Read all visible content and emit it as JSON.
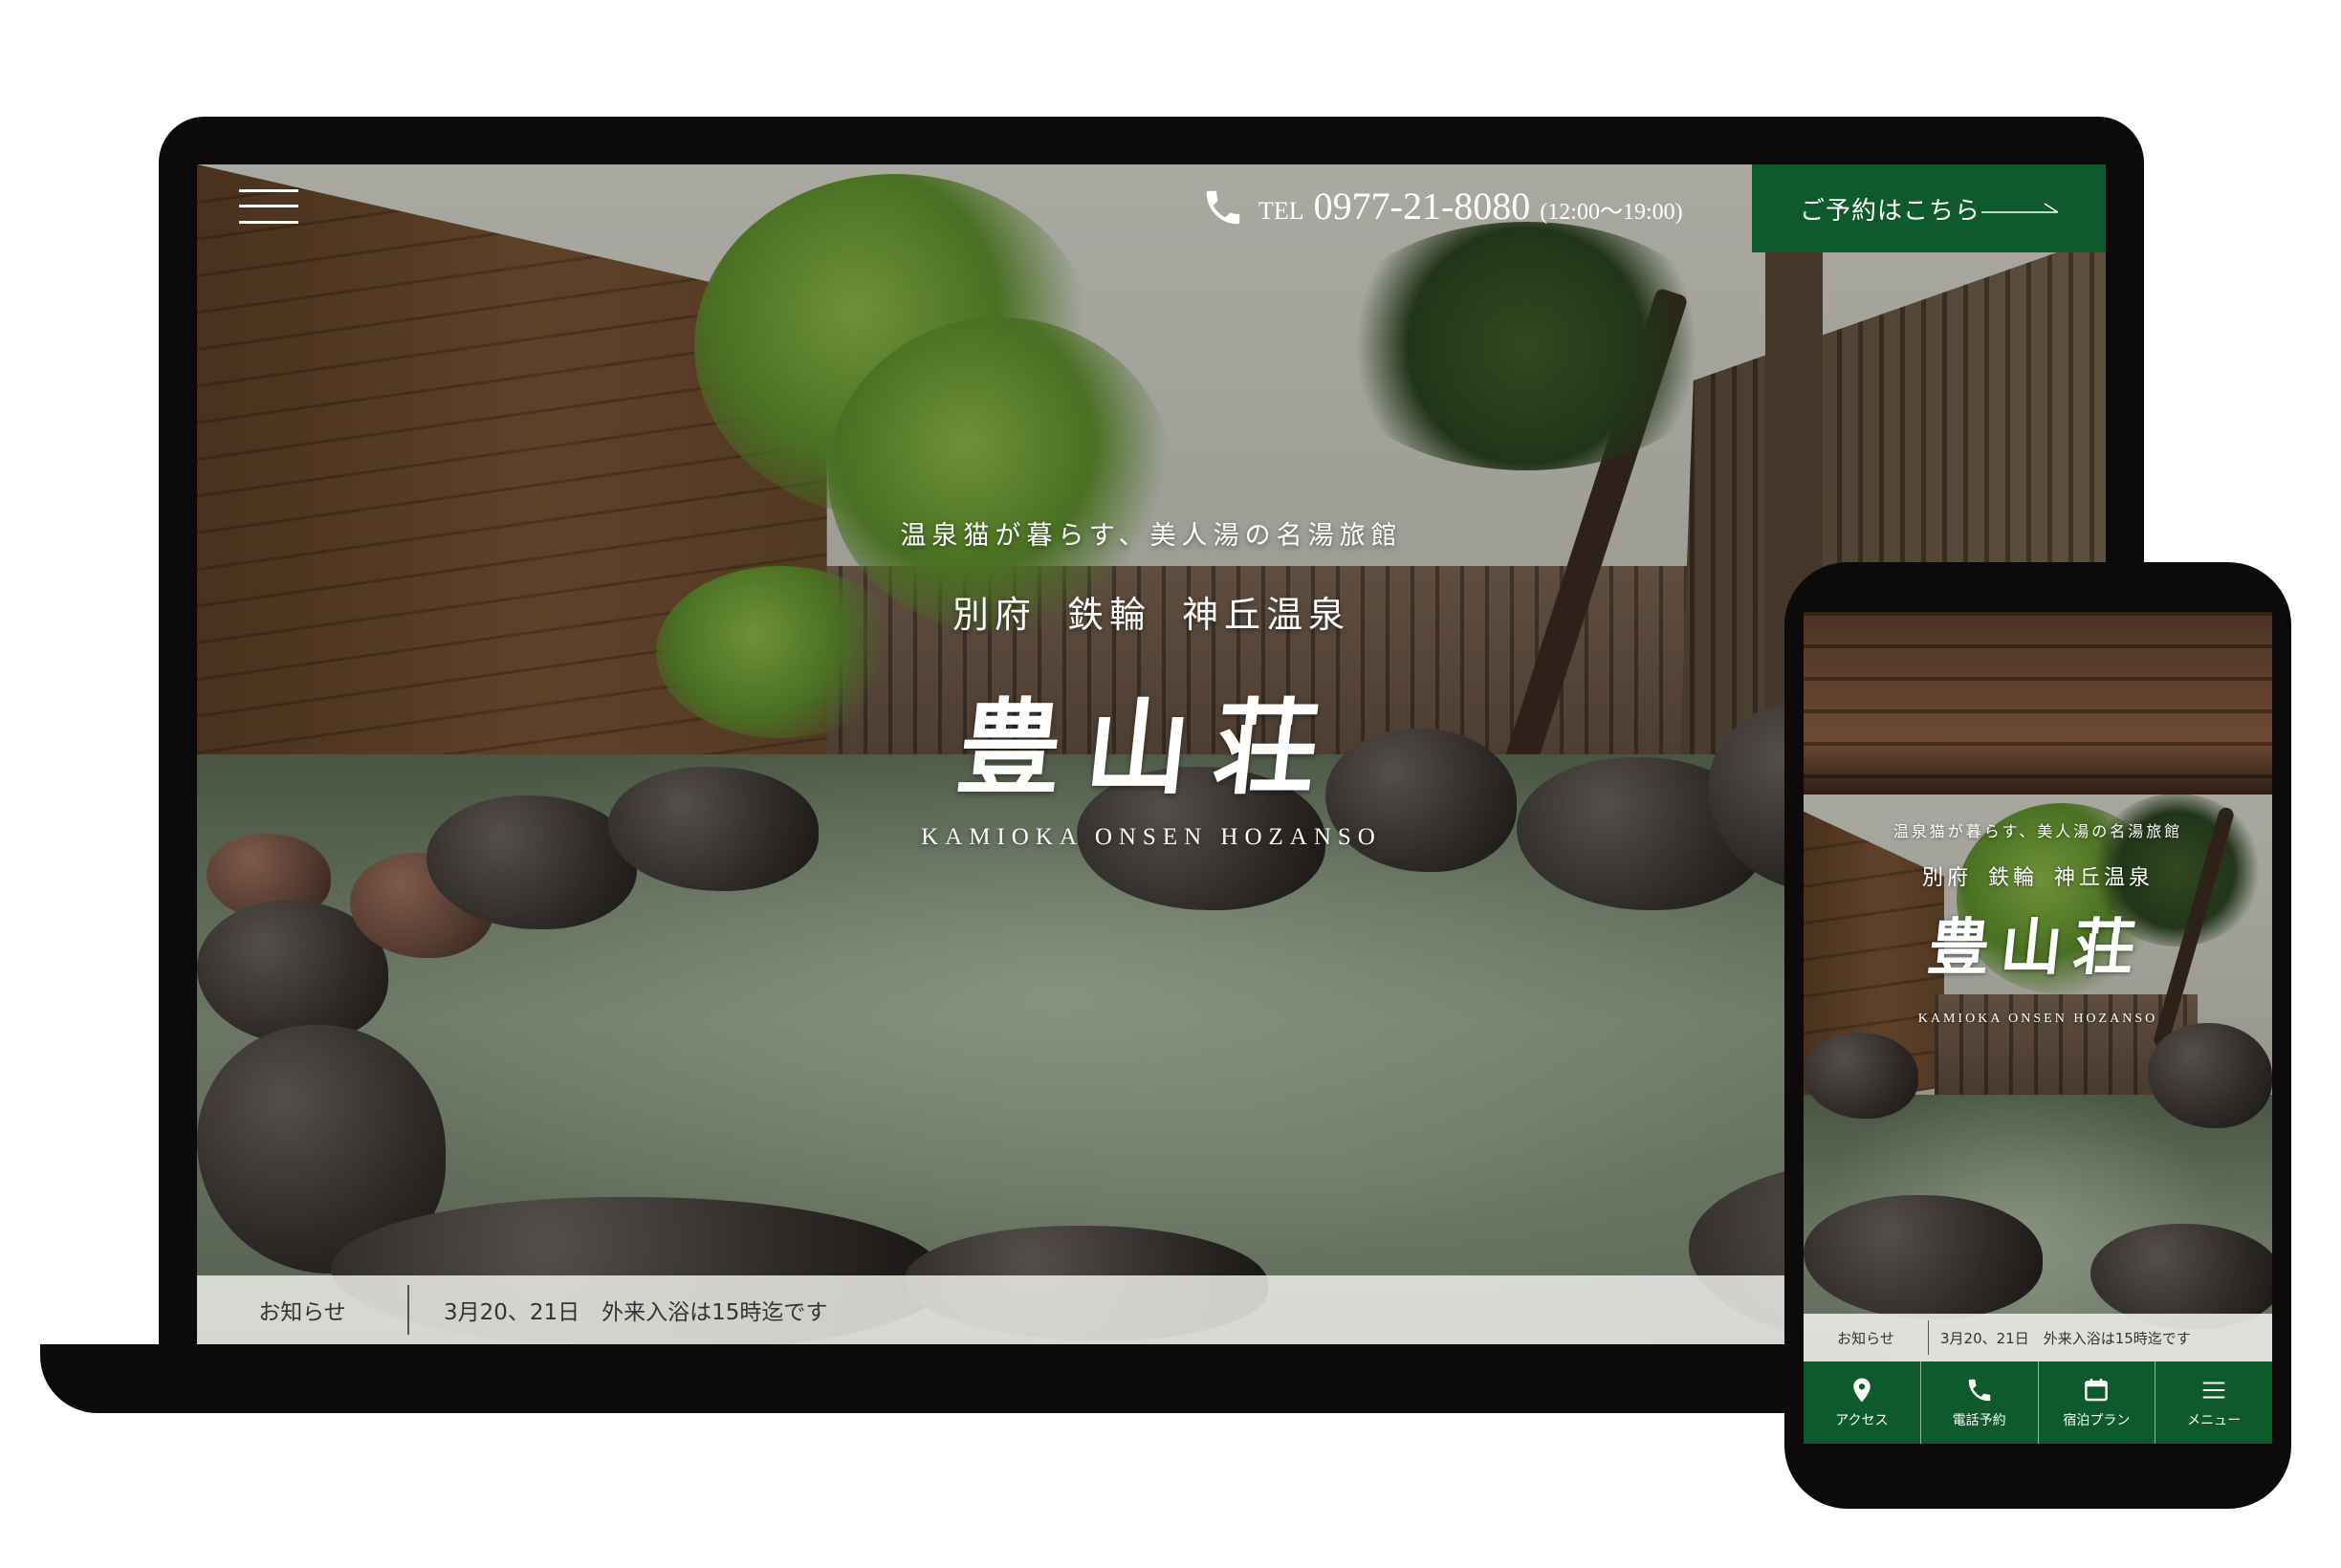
{
  "header": {
    "tel_label": "TEL",
    "tel_number": "0977-21-8080",
    "tel_hours": "(12:00〜19:00)",
    "reserve_label": "ご予約はこちら",
    "phone_icon": "phone-icon",
    "menu_icon": "hamburger-menu-icon",
    "arrow_icon": "arrow-right-icon"
  },
  "hero": {
    "tagline": "温泉猫が暮らす、美人湯の名湯旅館",
    "location": "別府 鉄輪 神丘温泉",
    "logo": "豊山荘",
    "romaji": "KAMIOKA ONSEN HOZANSO"
  },
  "news": {
    "label": "お知らせ",
    "text": "3月20、21日　外来入浴は15時迄です"
  },
  "mobile": {
    "tagline": "温泉猫が暮らす、美人湯の名湯旅館",
    "location": "別府 鉄輪 神丘温泉",
    "logo": "豊山荘",
    "romaji": "KAMIOKA ONSEN HOZANSO",
    "news_label": "お知らせ",
    "news_text": "3月20、21日　外来入浴は15時迄です",
    "nav": [
      {
        "label": "アクセス",
        "icon": "map-pin-icon"
      },
      {
        "label": "電話予約",
        "icon": "phone-icon"
      },
      {
        "label": "宿泊プラン",
        "icon": "calendar-icon"
      },
      {
        "label": "メニュー",
        "icon": "hamburger-menu-icon"
      }
    ]
  },
  "colors": {
    "brand_green": "#0f5a2c",
    "device_black": "#0c0a0a",
    "news_bar": "#ebebe8"
  }
}
